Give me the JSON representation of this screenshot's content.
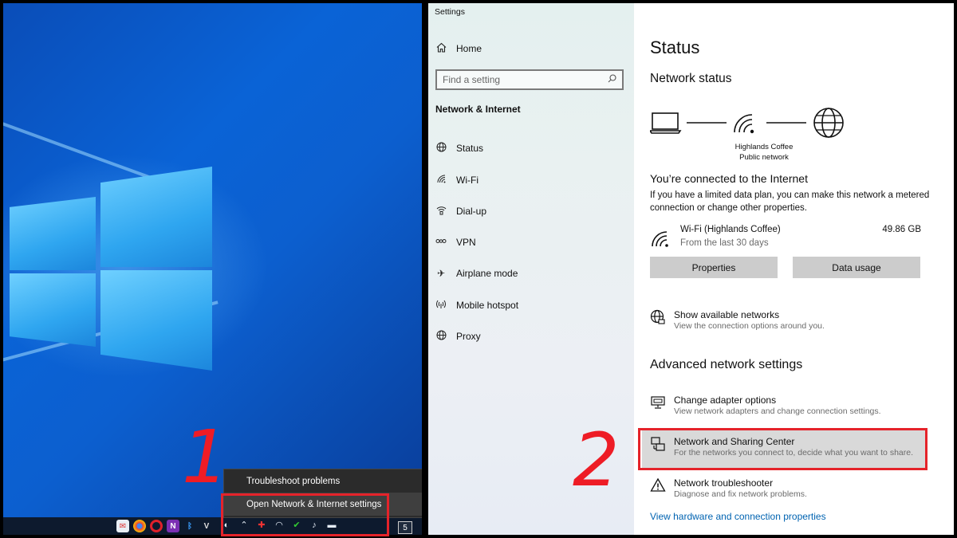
{
  "desktop": {
    "context_menu": {
      "items": [
        "Troubleshoot problems",
        "Open Network & Internet settings"
      ]
    },
    "tray": {
      "notification_count": "5"
    },
    "step_label": "1"
  },
  "settings": {
    "window_title": "Settings",
    "sidebar": {
      "home_label": "Home",
      "search_placeholder": "Find a setting",
      "section_title": "Network & Internet",
      "items": [
        {
          "label": "Status",
          "icon": "globe-icon"
        },
        {
          "label": "Wi-Fi",
          "icon": "wifi-icon"
        },
        {
          "label": "Dial-up",
          "icon": "dialup-icon"
        },
        {
          "label": "VPN",
          "icon": "vpn-icon"
        },
        {
          "label": "Airplane mode",
          "icon": "airplane-icon"
        },
        {
          "label": "Mobile hotspot",
          "icon": "hotspot-icon"
        },
        {
          "label": "Proxy",
          "icon": "globe-icon"
        }
      ]
    },
    "main": {
      "page_title": "Status",
      "network_status_heading": "Network status",
      "network_name": "Highlands Coffee",
      "network_type": "Public network",
      "connected_heading": "You’re connected to the Internet",
      "connected_desc": "If you have a limited data plan, you can make this network a metered connection or change other properties.",
      "connection": {
        "name": "Wi-Fi (Highlands Coffee)",
        "period": "From the last 30 days",
        "usage": "49.86 GB"
      },
      "buttons": {
        "properties": "Properties",
        "data_usage": "Data usage"
      },
      "show_networks": {
        "title": "Show available networks",
        "desc": "View the connection options around you."
      },
      "advanced_heading": "Advanced network settings",
      "advanced_items": [
        {
          "title": "Change adapter options",
          "desc": "View network adapters and change connection settings."
        },
        {
          "title": "Network and Sharing Center",
          "desc": "For the networks you connect to, decide what you want to share."
        },
        {
          "title": "Network troubleshooter",
          "desc": "Diagnose and fix network problems."
        }
      ],
      "hardware_link": "View hardware and connection properties"
    },
    "step_label": "2"
  },
  "colors": {
    "highlight_red": "#e5232a",
    "step_red": "#ee1c25",
    "link_blue": "#0063b1",
    "desktop_blue": "#0a63d6"
  }
}
